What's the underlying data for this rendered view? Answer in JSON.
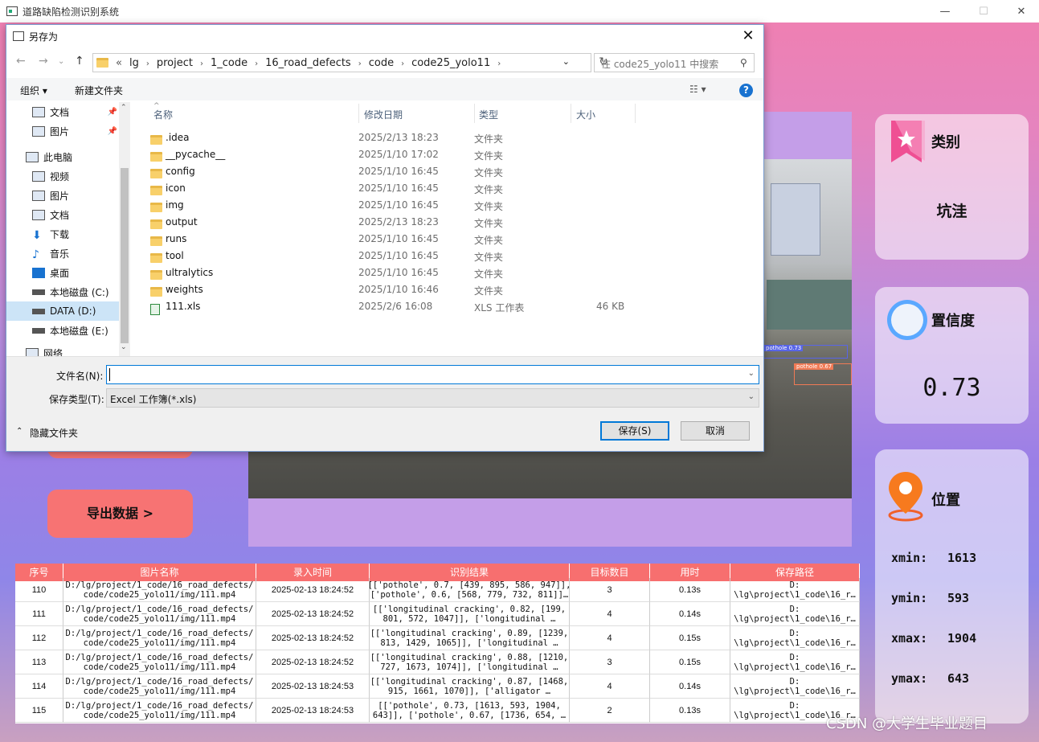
{
  "main_window": {
    "title": "道路缺陷检测识别系统",
    "min": "—",
    "max": "☐",
    "close": "✕"
  },
  "dialog": {
    "title": "另存为",
    "address": {
      "prefix": "«",
      "segments": [
        "lg",
        "project",
        "1_code",
        "16_road_defects",
        "code",
        "code25_yolo11"
      ]
    },
    "search_placeholder": "在 code25_yolo11 中搜索",
    "toolbar": {
      "organize": "组织 ▾",
      "new_folder": "新建文件夹"
    },
    "nav_items": [
      {
        "label": "文档",
        "pinned": true
      },
      {
        "label": "图片",
        "pinned": true
      },
      {
        "label": "此电脑"
      },
      {
        "label": "视频"
      },
      {
        "label": "图片"
      },
      {
        "label": "文档"
      },
      {
        "label": "下载"
      },
      {
        "label": "音乐"
      },
      {
        "label": "桌面"
      },
      {
        "label": "本地磁盘 (C:)"
      },
      {
        "label": "DATA (D:)"
      },
      {
        "label": "本地磁盘 (E:)"
      },
      {
        "label": "网络"
      }
    ],
    "columns": [
      "名称",
      "修改日期",
      "类型",
      "大小"
    ],
    "files": [
      {
        "name": ".idea",
        "date": "2025/2/13 18:23",
        "type": "文件夹",
        "size": ""
      },
      {
        "name": "__pycache__",
        "date": "2025/1/10 17:02",
        "type": "文件夹",
        "size": ""
      },
      {
        "name": "config",
        "date": "2025/1/10 16:45",
        "type": "文件夹",
        "size": ""
      },
      {
        "name": "icon",
        "date": "2025/1/10 16:45",
        "type": "文件夹",
        "size": ""
      },
      {
        "name": "img",
        "date": "2025/1/10 16:45",
        "type": "文件夹",
        "size": ""
      },
      {
        "name": "output",
        "date": "2025/2/13 18:23",
        "type": "文件夹",
        "size": ""
      },
      {
        "name": "runs",
        "date": "2025/1/10 16:45",
        "type": "文件夹",
        "size": ""
      },
      {
        "name": "tool",
        "date": "2025/1/10 16:45",
        "type": "文件夹",
        "size": ""
      },
      {
        "name": "ultralytics",
        "date": "2025/1/10 16:45",
        "type": "文件夹",
        "size": ""
      },
      {
        "name": "weights",
        "date": "2025/1/10 16:46",
        "type": "文件夹",
        "size": ""
      },
      {
        "name": "111.xls",
        "date": "2025/2/6 16:08",
        "type": "XLS 工作表",
        "size": "46 KB"
      }
    ],
    "filename_label": "文件名(N):",
    "filename_value": "",
    "filetype_label": "保存类型(T):",
    "filetype_value": "Excel 工作簿(*.xls)",
    "hide_folders": "隐藏文件夹",
    "save": "保存(S)",
    "cancel": "取消"
  },
  "cards": {
    "category": {
      "label": "类别",
      "value": "坑洼"
    },
    "confidence": {
      "label": "置信度",
      "value": "0.73"
    },
    "position": {
      "label": "位置",
      "xmin": "1613",
      "ymin": "593",
      "xmax": "1904",
      "ymax": "643",
      "xmin_label": "xmin:",
      "ymin_label": "ymin:",
      "xmax_label": "xmax:",
      "ymax_label": "ymax:"
    }
  },
  "detections_overlay": [
    {
      "label": "pothole 0.73"
    },
    {
      "label": "pothole 0.67"
    }
  ],
  "export_button": "导出数据 >",
  "table": {
    "headers": [
      "序号",
      "图片名称",
      "录入时间",
      "识别结果",
      "目标数目",
      "用时",
      "保存路径"
    ],
    "rows": [
      {
        "id": "110",
        "name": "D:/lg/project/1_code/16_road_defects/\ncode/code25_yolo11/img/111.mp4",
        "time": "2025-02-13 18:24:52",
        "result": "[['pothole', 0.7, [439, 895, 586, 947]],\n['pothole', 0.6, [568, 779, 732, 811]]…",
        "count": "3",
        "elapsed": "0.13s",
        "path": "D:\n\\lg\\project\\1_code\\16_r…"
      },
      {
        "id": "111",
        "name": "D:/lg/project/1_code/16_road_defects/\ncode/code25_yolo11/img/111.mp4",
        "time": "2025-02-13 18:24:52",
        "result": "[['longitudinal cracking', 0.82, [199,\n801, 572, 1047]], ['longitudinal …",
        "count": "4",
        "elapsed": "0.14s",
        "path": "D:\n\\lg\\project\\1_code\\16_r…"
      },
      {
        "id": "112",
        "name": "D:/lg/project/1_code/16_road_defects/\ncode/code25_yolo11/img/111.mp4",
        "time": "2025-02-13 18:24:52",
        "result": "[['longitudinal cracking', 0.89, [1239,\n813, 1429, 1065]], ['longitudinal …",
        "count": "4",
        "elapsed": "0.15s",
        "path": "D:\n\\lg\\project\\1_code\\16_r…"
      },
      {
        "id": "113",
        "name": "D:/lg/project/1_code/16_road_defects/\ncode/code25_yolo11/img/111.mp4",
        "time": "2025-02-13 18:24:52",
        "result": "[['longitudinal cracking', 0.88, [1210,\n727, 1673, 1074]], ['longitudinal …",
        "count": "3",
        "elapsed": "0.15s",
        "path": "D:\n\\lg\\project\\1_code\\16_r…"
      },
      {
        "id": "114",
        "name": "D:/lg/project/1_code/16_road_defects/\ncode/code25_yolo11/img/111.mp4",
        "time": "2025-02-13 18:24:53",
        "result": "[['longitudinal cracking', 0.87, [1468,\n915, 1661, 1070]], ['alligator …",
        "count": "4",
        "elapsed": "0.14s",
        "path": "D:\n\\lg\\project\\1_code\\16_r…"
      },
      {
        "id": "115",
        "name": "D:/lg/project/1_code/16_road_defects/\ncode/code25_yolo11/img/111.mp4",
        "time": "2025-02-13 18:24:53",
        "result": "[['pothole', 0.73, [1613, 593, 1904,\n643]], ['pothole', 0.67, [1736, 654, …",
        "count": "2",
        "elapsed": "0.13s",
        "path": "D:\n\\lg\\project\\1_code\\16_r…"
      }
    ]
  },
  "watermark": "CSDN @大学生毕业题目"
}
